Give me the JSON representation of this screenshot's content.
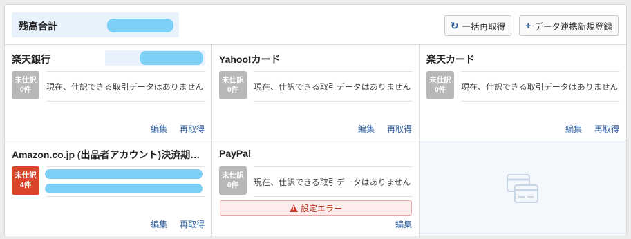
{
  "header": {
    "balance_label": "残高合計",
    "refetch_all_label": "一括再取得",
    "add_link_label": "データ連携新規登録"
  },
  "accounts": [
    {
      "name": "楽天銀行",
      "badge_top": "未仕訳",
      "badge_count": "0件",
      "message": "現在、仕訳できる取引データはありません",
      "edit": "編集",
      "refetch": "再取得"
    },
    {
      "name": "Yahoo!カード",
      "badge_top": "未仕訳",
      "badge_count": "0件",
      "message": "現在、仕訳できる取引データはありません",
      "edit": "編集",
      "refetch": "再取得"
    },
    {
      "name": "楽天カード",
      "badge_top": "未仕訳",
      "badge_count": "0件",
      "message": "現在、仕訳できる取引データはありません",
      "edit": "編集",
      "refetch": "再取得"
    },
    {
      "name": "Amazon.co.jp (出品者アカウント)決済期…",
      "badge_top": "未仕訳",
      "badge_count": "4件",
      "edit": "編集",
      "refetch": "再取得"
    },
    {
      "name": "PayPal",
      "badge_top": "未仕訳",
      "badge_count": "0件",
      "message": "現在、仕訳できる取引データはありません",
      "error": "設定エラー",
      "edit": "編集"
    }
  ],
  "colors": {
    "accent": "#2f5f9e",
    "badge_gray": "#b8b8b8",
    "badge_red": "#d9442b",
    "error_text": "#c0392b",
    "balance_bg": "#e8f2fd"
  },
  "icons": {
    "refetch": "refresh-icon",
    "add": "plus-icon",
    "empty_slot": "credit-card-icon"
  }
}
